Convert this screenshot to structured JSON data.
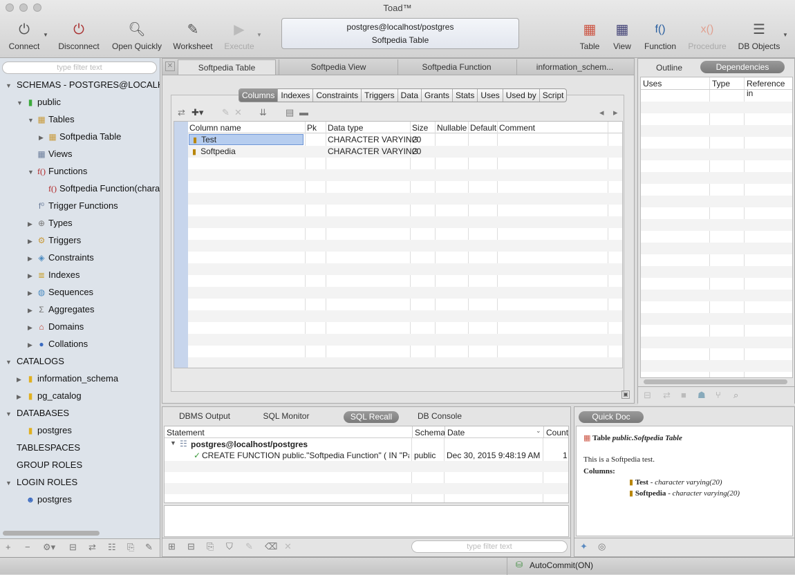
{
  "window": {
    "title": "Toad™"
  },
  "toolbar": {
    "left": [
      {
        "label": "Connect",
        "icon": "plug-icon"
      },
      {
        "label": "Disconnect",
        "icon": "unplug-icon"
      },
      {
        "label": "Open Quickly",
        "icon": "magnifier-icon"
      },
      {
        "label": "Worksheet",
        "icon": "worksheet-icon"
      },
      {
        "label": "Execute",
        "icon": "play-icon",
        "disabled": true
      }
    ],
    "connection_line1": "postgres@localhost/postgres",
    "connection_line2": "Softpedia Table",
    "right": [
      {
        "label": "Table",
        "icon": "table-icon"
      },
      {
        "label": "View",
        "icon": "view-icon"
      },
      {
        "label": "Function",
        "icon": "function-icon"
      },
      {
        "label": "Procedure",
        "icon": "procedure-icon",
        "disabled": true
      },
      {
        "label": "DB Objects",
        "icon": "db-objects-icon"
      }
    ]
  },
  "left": {
    "filter_placeholder": "type filter text",
    "tree": [
      {
        "label": "SCHEMAS - POSTGRES@LOCALHO",
        "level": 0,
        "toggle": "open",
        "icon": ""
      },
      {
        "label": "public",
        "level": 1,
        "toggle": "open",
        "icon": "db"
      },
      {
        "label": "Tables",
        "level": 2,
        "toggle": "open",
        "icon": "tables"
      },
      {
        "label": "Softpedia Table",
        "level": 3,
        "toggle": "closed",
        "icon": "table"
      },
      {
        "label": "Views",
        "level": 2,
        "toggle": "",
        "icon": "views"
      },
      {
        "label": "Functions",
        "level": 2,
        "toggle": "open",
        "icon": "func"
      },
      {
        "label": "Softpedia Function(chara",
        "level": 3,
        "toggle": "",
        "icon": "func"
      },
      {
        "label": "Trigger Functions",
        "level": 2,
        "toggle": "",
        "icon": "trigfunc"
      },
      {
        "label": "Types",
        "level": 2,
        "toggle": "closed",
        "icon": "types"
      },
      {
        "label": "Triggers",
        "level": 2,
        "toggle": "closed",
        "icon": "triggers"
      },
      {
        "label": "Constraints",
        "level": 2,
        "toggle": "closed",
        "icon": "constraints"
      },
      {
        "label": "Indexes",
        "level": 2,
        "toggle": "closed",
        "icon": "indexes"
      },
      {
        "label": "Sequences",
        "level": 2,
        "toggle": "closed",
        "icon": "sequences"
      },
      {
        "label": "Aggregates",
        "level": 2,
        "toggle": "closed",
        "icon": "aggregates"
      },
      {
        "label": "Domains",
        "level": 2,
        "toggle": "closed",
        "icon": "domains"
      },
      {
        "label": "Collations",
        "level": 2,
        "toggle": "closed",
        "icon": "collations"
      },
      {
        "label": "CATALOGS",
        "level": 0,
        "toggle": "open",
        "icon": ""
      },
      {
        "label": "information_schema",
        "level": 1,
        "toggle": "closed",
        "icon": "dbyellow"
      },
      {
        "label": "pg_catalog",
        "level": 1,
        "toggle": "closed",
        "icon": "dbyellow"
      },
      {
        "label": "DATABASES",
        "level": 0,
        "toggle": "open",
        "icon": ""
      },
      {
        "label": "postgres",
        "level": 1,
        "toggle": "",
        "icon": "dbyellow"
      },
      {
        "label": "TABLESPACES",
        "level": 0,
        "toggle": "",
        "icon": ""
      },
      {
        "label": "GROUP ROLES",
        "level": 0,
        "toggle": "",
        "icon": ""
      },
      {
        "label": "LOGIN ROLES",
        "level": 0,
        "toggle": "open",
        "icon": ""
      },
      {
        "label": "postgres",
        "level": 1,
        "toggle": "",
        "icon": "user"
      }
    ]
  },
  "editor": {
    "tabs": [
      "Softpedia Table",
      "Softpedia View",
      "Softpedia Function",
      "information_schem..."
    ],
    "subtabs": [
      "Columns",
      "Indexes",
      "Constraints",
      "Triggers",
      "Data",
      "Grants",
      "Stats",
      "Uses",
      "Used by",
      "Script"
    ],
    "active_subtab": "Columns",
    "columns": [
      "Column name",
      "Pk",
      "Data type",
      "Size",
      "Nullable",
      "Default",
      "Comment"
    ],
    "rows": [
      {
        "name": "Test",
        "pk": "",
        "type": "CHARACTER VARYING",
        "size": "20",
        "nullable": "",
        "default": "",
        "comment": ""
      },
      {
        "name": "Softpedia",
        "pk": "",
        "type": "CHARACTER VARYING",
        "size": "20",
        "nullable": "",
        "default": "",
        "comment": ""
      }
    ]
  },
  "right": {
    "tabs": [
      "Outline",
      "Dependencies"
    ],
    "active": "Dependencies",
    "columns": [
      "Uses",
      "Type",
      "Reference in"
    ]
  },
  "bottom": {
    "tabs": [
      "DBMS Output",
      "SQL Monitor",
      "SQL Recall",
      "DB Console"
    ],
    "active": "SQL Recall",
    "columns": [
      "Statement",
      "Schema",
      "Date",
      "Count"
    ],
    "group": "postgres@localhost/postgres",
    "rows": [
      {
        "statement": "CREATE FUNCTION public.\"Softpedia Function\" ( IN \"Pa...",
        "schema": "public",
        "date": "Dec 30, 2015 9:48:19 AM",
        "count": "1"
      }
    ],
    "filter_placeholder": "type filter text"
  },
  "quickdoc": {
    "tab": "Quick Doc",
    "heading_prefix": "Table",
    "heading_name": "public.Softpedia Table",
    "description": "This is a Softpedia test.",
    "columns_label": "Columns:",
    "columns": [
      {
        "name": "Test",
        "type": "character varying(20)"
      },
      {
        "name": "Softpedia",
        "type": "character varying(20)"
      }
    ]
  },
  "status": {
    "autocommit": "AutoCommit(ON)"
  },
  "colors": {
    "selection": "#b6cdef",
    "sidebar": "#dde3ea",
    "tab_active": "#888888"
  }
}
